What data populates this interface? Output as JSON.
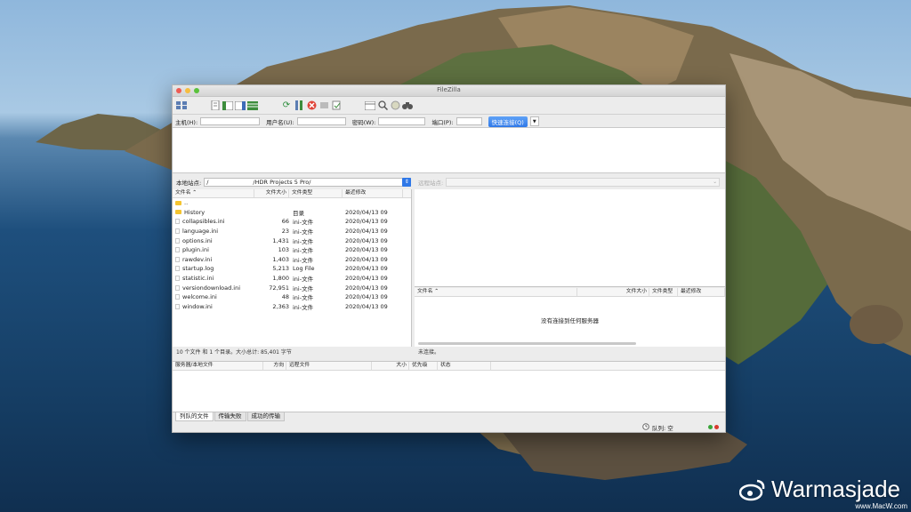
{
  "window": {
    "title": "FileZilla"
  },
  "traffic_lights": [
    "#ee5b53",
    "#f6bd40",
    "#5ac23c"
  ],
  "quickconnect": {
    "host_label": "主机(H):",
    "user_label": "用户名(U):",
    "pass_label": "密码(W):",
    "port_label": "端口(P):",
    "connect_button": "快速连接(Q)",
    "dropdown_glyph": "▼"
  },
  "local": {
    "site_label": "本地站点:",
    "path_prefix": "/",
    "path": "/HDR Projects 5 Pro/",
    "dropdown_glyph": "⇕",
    "columns": {
      "name": "文件名 ⌃",
      "size": "文件大小",
      "type": "文件类型",
      "date": "最近修改"
    },
    "rows": [
      {
        "name": "..",
        "size": "",
        "type": "",
        "date": "",
        "icon": "folder"
      },
      {
        "name": "History",
        "size": "",
        "type": "目录",
        "date": "2020/04/13 09",
        "icon": "folder"
      },
      {
        "name": "collapsibles.ini",
        "size": "66",
        "type": "ini-文件",
        "date": "2020/04/13 09",
        "icon": "file"
      },
      {
        "name": "language.ini",
        "size": "23",
        "type": "ini-文件",
        "date": "2020/04/13 09",
        "icon": "file"
      },
      {
        "name": "options.ini",
        "size": "1,431",
        "type": "ini-文件",
        "date": "2020/04/13 09",
        "icon": "file"
      },
      {
        "name": "plugin.ini",
        "size": "103",
        "type": "ini-文件",
        "date": "2020/04/13 09",
        "icon": "file"
      },
      {
        "name": "rawdev.ini",
        "size": "1,403",
        "type": "ini-文件",
        "date": "2020/04/13 09",
        "icon": "file"
      },
      {
        "name": "startup.log",
        "size": "5,213",
        "type": "Log File",
        "date": "2020/04/13 09",
        "icon": "file"
      },
      {
        "name": "statistic.ini",
        "size": "1,800",
        "type": "ini-文件",
        "date": "2020/04/13 09",
        "icon": "file"
      },
      {
        "name": "versiondownload.ini",
        "size": "72,951",
        "type": "ini-文件",
        "date": "2020/04/13 09",
        "icon": "file"
      },
      {
        "name": "welcome.ini",
        "size": "48",
        "type": "ini-文件",
        "date": "2020/04/13 09",
        "icon": "file"
      },
      {
        "name": "window.ini",
        "size": "2,363",
        "type": "ini-文件",
        "date": "2020/04/13 09",
        "icon": "file"
      }
    ],
    "status": "10 个文件 和 1 个目录。大小总计: 85,401 字节"
  },
  "remote": {
    "site_label": "远程站点:",
    "columns": {
      "name": "文件名 ⌃",
      "size": "文件大小",
      "type": "文件类型",
      "date": "最近修改"
    },
    "empty_message": "没有连接到任何服务器",
    "status": "未连接。"
  },
  "queue": {
    "columns": [
      "服务器/本地文件",
      "方向",
      "远程文件",
      "大小",
      "优先级",
      "状态"
    ],
    "tabs": [
      "列队的文件",
      "传输失败",
      "成功的传输"
    ],
    "status": "队列: 空"
  },
  "watermark": {
    "text": "Warmasjade",
    "url": "www.MacW.com"
  }
}
